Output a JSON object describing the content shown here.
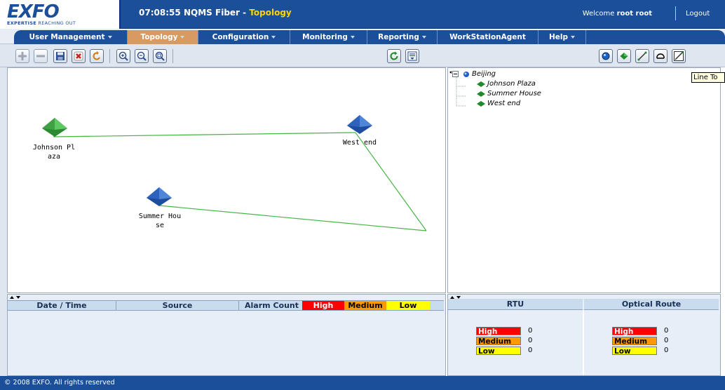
{
  "header": {
    "logo_text": "EXFO",
    "logo_tagline_a": "EXPERTISE",
    "logo_tagline_b": " REACHING OUT",
    "time": "07:08:55",
    "app_name": "NQMS Fiber",
    "view_sep": " - ",
    "view_name": "Topology",
    "welcome_prefix": "Welcome ",
    "user": "root root",
    "logout": "Logout"
  },
  "menu": [
    {
      "label": "User Management",
      "active": false
    },
    {
      "label": "Topology",
      "active": true
    },
    {
      "label": "Configuration",
      "active": false
    },
    {
      "label": "Monitoring",
      "active": false
    },
    {
      "label": "Reporting",
      "active": false
    },
    {
      "label": "WorkStationAgent",
      "active": false
    },
    {
      "label": "Help",
      "active": false
    }
  ],
  "toolbar": {
    "left_icons": [
      "add-icon",
      "remove-icon",
      "save-icon",
      "delete-icon",
      "undo-icon",
      "zoom-in-icon",
      "zoom-out-icon",
      "zoom-fit-icon"
    ],
    "center_icons": [
      "refresh-icon",
      "list-icon"
    ],
    "right_icons": [
      "site-tool-icon",
      "node-tool-icon",
      "line-tool-icon",
      "loop-tool-icon",
      "line-to-tool-icon"
    ],
    "tooltip": "Line To"
  },
  "map": {
    "nodes": [
      {
        "name_line1": "Johnson Pl",
        "name_line2": "aza",
        "color": "green"
      },
      {
        "name_line1": "West end",
        "name_line2": "",
        "color": "blue"
      },
      {
        "name_line1": "Summer Hou",
        "name_line2": "se",
        "color": "blue"
      }
    ]
  },
  "tree": {
    "root": "Beijing",
    "children": [
      "Johnson Plaza",
      "Summer House",
      "West end"
    ]
  },
  "alarm_table": {
    "columns": [
      "Date / Time",
      "Source",
      "Alarm Count"
    ],
    "severity": [
      {
        "label": "High",
        "color": "#ff0000",
        "text_color": "#ffffff"
      },
      {
        "label": "Medium",
        "color": "#ff9900",
        "text_color": "#000000"
      },
      {
        "label": "Low",
        "color": "#ffff00",
        "text_color": "#000000"
      }
    ],
    "rows": []
  },
  "summary": {
    "rtu": {
      "title": "RTU",
      "counts": [
        {
          "label": "High",
          "value": "0",
          "color": "#ff0000",
          "text_color": "#ffffff"
        },
        {
          "label": "Medium",
          "value": "0",
          "color": "#ff9900",
          "text_color": "#000000"
        },
        {
          "label": "Low",
          "value": "0",
          "color": "#ffff00",
          "text_color": "#000000"
        }
      ]
    },
    "optical_route": {
      "title": "Optical Route",
      "counts": [
        {
          "label": "High",
          "value": "0",
          "color": "#ff0000",
          "text_color": "#ffffff"
        },
        {
          "label": "Medium",
          "value": "0",
          "color": "#ff9900",
          "text_color": "#000000"
        },
        {
          "label": "Low",
          "value": "0",
          "color": "#ffff00",
          "text_color": "#000000"
        }
      ]
    }
  },
  "footer": {
    "copyright": "© 2008 EXFO. All rights reserved"
  },
  "colors": {
    "brand_blue": "#1b4f9a",
    "active_menu": "#d69a62",
    "node_green": "#2f9a36",
    "node_blue": "#2f5fb5",
    "link_green": "#45b545"
  }
}
